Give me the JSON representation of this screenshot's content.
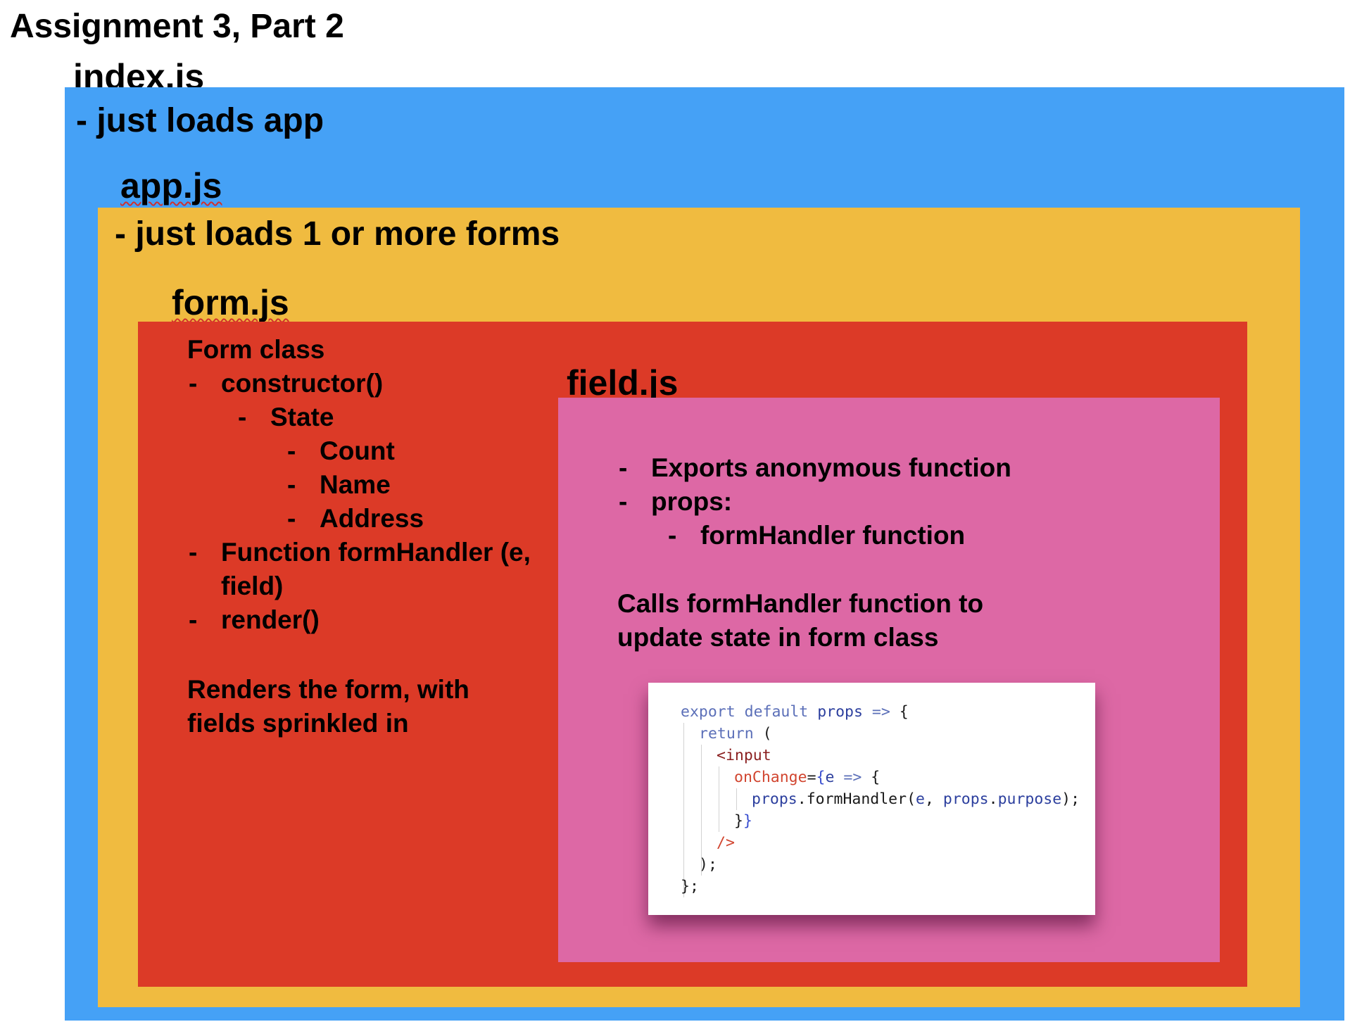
{
  "title": "Assignment 3, Part 2",
  "index": {
    "filename": "index.js",
    "description": "- just loads app",
    "color": "#45a1f6"
  },
  "app": {
    "filename": "app.js",
    "description": "- just loads 1 or more forms",
    "color": "#f0bb40"
  },
  "form": {
    "filename": "form.js",
    "color": "#dc3a27",
    "class_label": "Form class",
    "items": {
      "constructor": "constructor()",
      "state": "State",
      "count": "Count",
      "name": "Name",
      "address": "Address",
      "form_handler": "Function formHandler (e, field)",
      "render": "render()"
    },
    "note": "Renders the form, with fields sprinkled in"
  },
  "field": {
    "filename": "field.js",
    "color": "#dd68a5",
    "items": {
      "exports": "Exports anonymous function",
      "props": "props:",
      "form_handler": "formHandler function"
    },
    "note": "Calls formHandler function to update state in form class"
  },
  "code": {
    "l1_export": "export",
    "l1_default": "default",
    "l1_props": "props",
    "l1_arrow": "=>",
    "l1_brace": "{",
    "l2_return": "return",
    "l2_paren": "(",
    "l3_tag": "<input",
    "l4_attr": "onChange",
    "l4_eq": "=",
    "l4_brace": "{",
    "l4_param": "e",
    "l4_arrow": "=>",
    "l4_body_brace": "{",
    "l5_props": "props",
    "l5_dot1": ".",
    "l5_method": "formHandler",
    "l5_open": "(",
    "l5_arg1": "e",
    "l5_comma": ", ",
    "l5_props2": "props",
    "l5_dot2": ".",
    "l5_purpose": "purpose",
    "l5_close": ");",
    "l6_close": "}",
    "l6_jsx": "}",
    "l7_selfclose": "/>",
    "l8_close": ");",
    "l9_close": "};"
  }
}
